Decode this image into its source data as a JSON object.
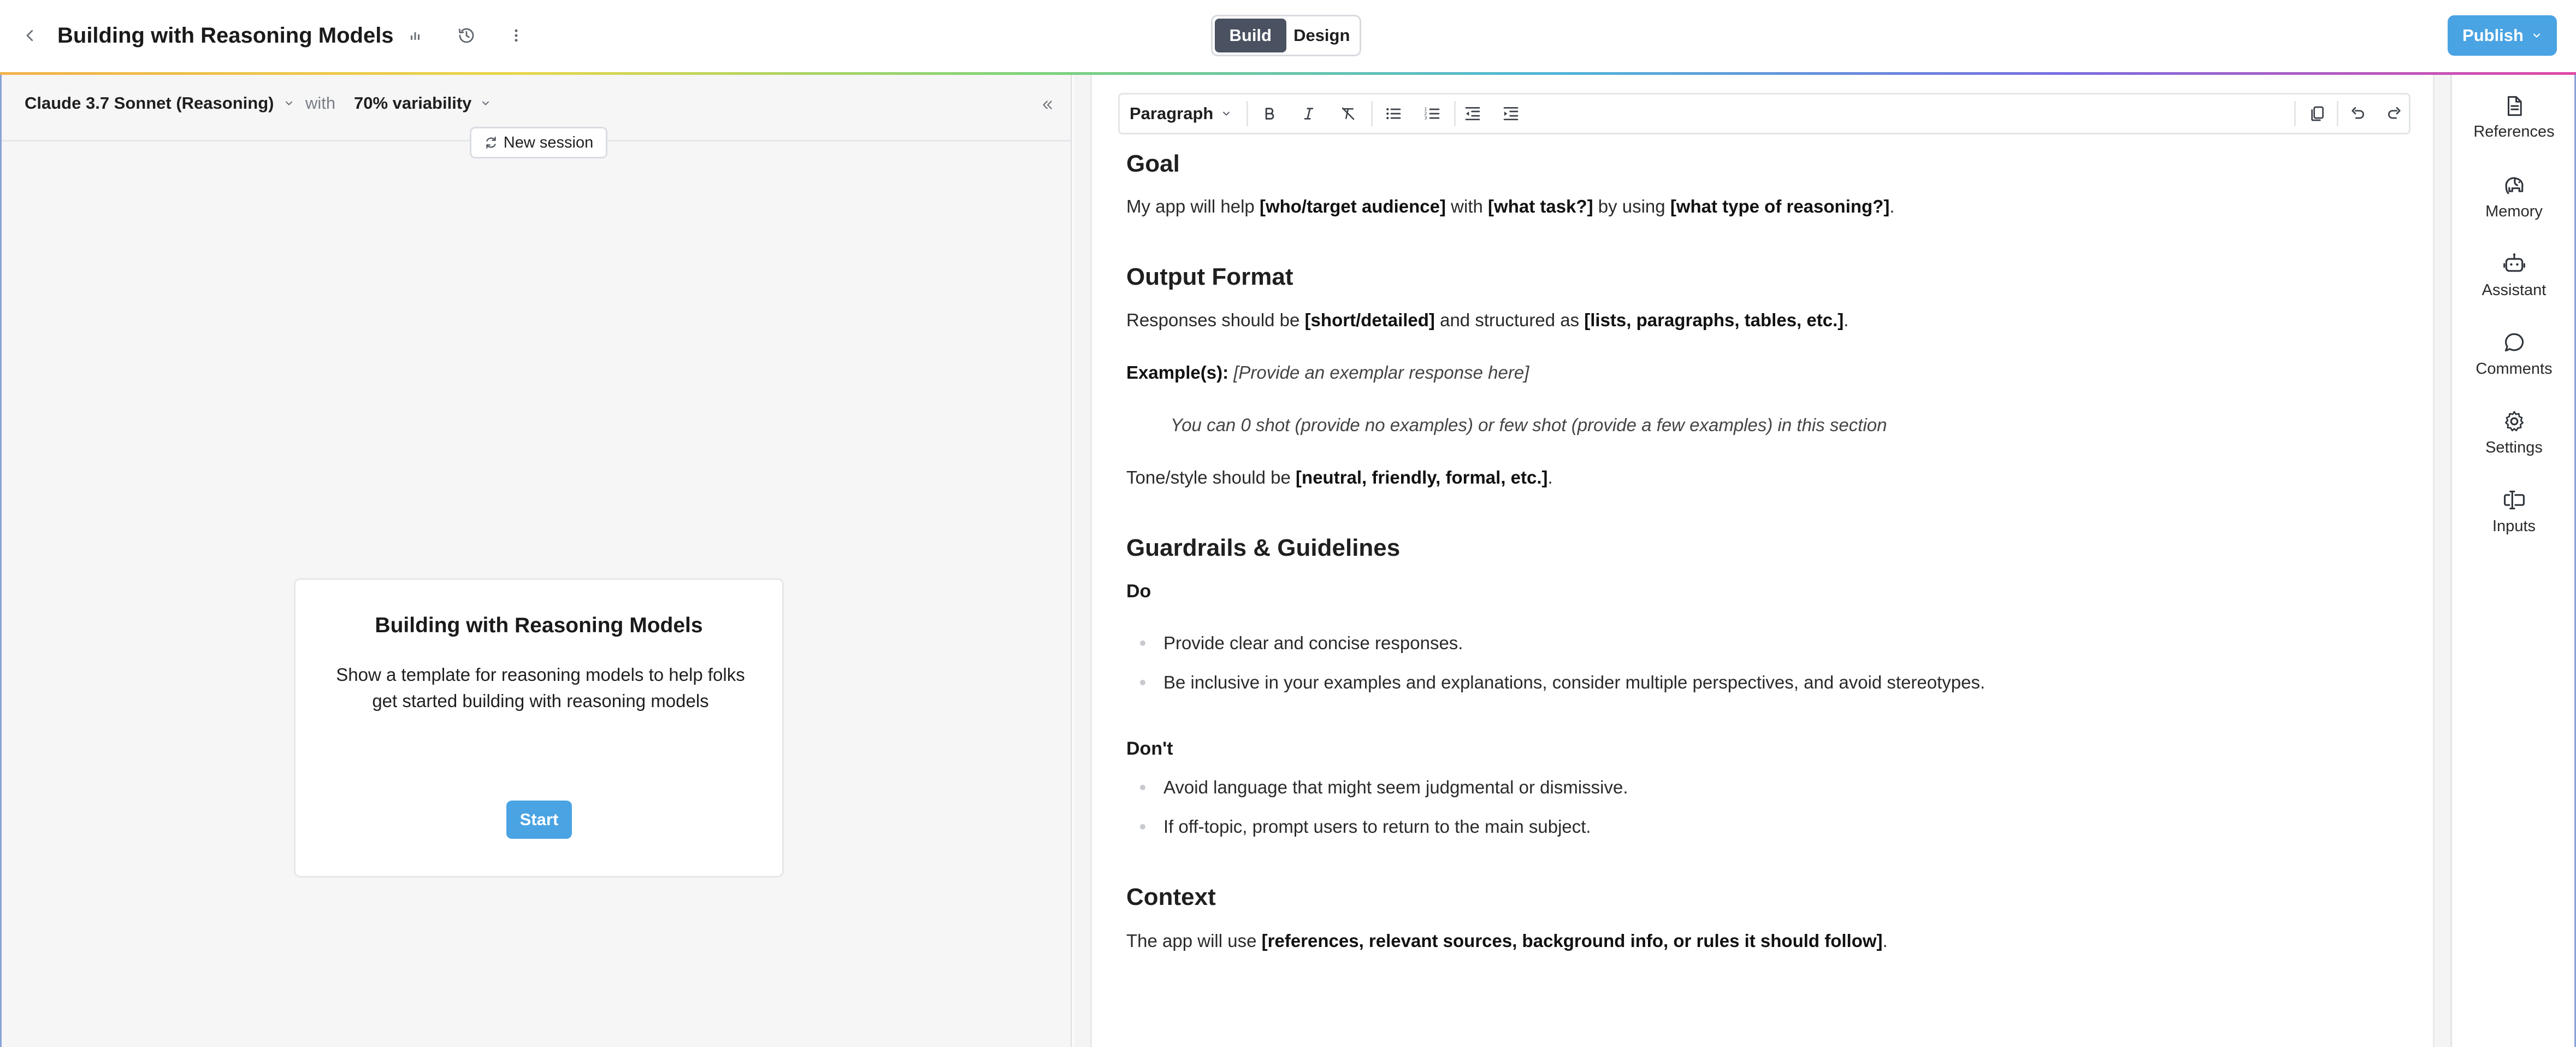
{
  "header": {
    "title": "Building with Reasoning Models",
    "modes": [
      "Build",
      "Design"
    ],
    "active_mode": "Build",
    "publish_label": "Publish"
  },
  "left_panel": {
    "model": "Claude 3.7 Sonnet (Reasoning)",
    "with_label": "with",
    "variability": "70% variability",
    "new_session_label": "New session",
    "card": {
      "title": "Building with Reasoning Models",
      "description": "Show a template for reasoning models to help folks get started building with reasoning models",
      "start_label": "Start"
    }
  },
  "toolbar": {
    "paragraph_style": "Paragraph"
  },
  "document": {
    "goal_heading": "Goal",
    "goal_line": {
      "t1": "My app will help ",
      "b1": "[who/target audience]",
      "t2": " with ",
      "b2": "[what task?]",
      "t3": " by using ",
      "b3": "[what type of reasoning?]",
      "t4": "."
    },
    "output_heading": "Output Format",
    "output_line": {
      "t1": "Responses should be ",
      "b1": "[short/detailed]",
      "t2": " and structured as ",
      "b2": "[lists, paragraphs, tables, etc.]",
      "t3": "."
    },
    "examples_label": "Example(s):",
    "examples_placeholder": "[Provide an exemplar response here]",
    "examples_note": "You can 0 shot (provide no examples) or few shot (provide a few examples) in this section",
    "tone_line": {
      "t1": "Tone/style should be ",
      "b1": "[neutral, friendly, formal, etc.]",
      "t2": "."
    },
    "guardrails_heading": "Guardrails & Guidelines",
    "do_label": "Do",
    "do_items": [
      "Provide clear and concise responses.",
      "Be inclusive in your examples and explanations, consider multiple perspectives, and avoid stereotypes."
    ],
    "dont_label": "Don't",
    "dont_items": [
      "Avoid language that might seem judgmental or dismissive.",
      "If off-topic, prompt users to return to the main subject."
    ],
    "context_heading": "Context",
    "context_line": {
      "t1": "The app will use ",
      "b1": "[references, relevant sources, background info, or rules it should follow]",
      "t2": "."
    }
  },
  "right_rail": {
    "items": [
      "References",
      "Memory",
      "Assistant",
      "Comments",
      "Settings",
      "Inputs"
    ]
  },
  "colors": {
    "accent": "#4aa3e3",
    "active_mode_bg": "#4a5261",
    "pane_bg": "#f6f6f7"
  }
}
